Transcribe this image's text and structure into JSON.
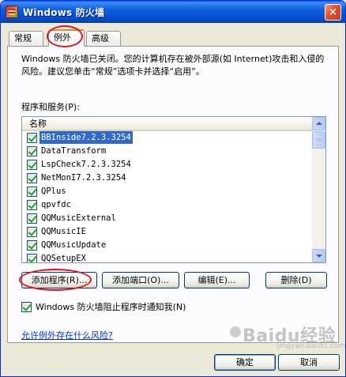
{
  "window": {
    "title": "Windows 防火墙",
    "close_label": "×"
  },
  "tabs": [
    {
      "label": "常规",
      "active": false
    },
    {
      "label": "例外",
      "active": true
    },
    {
      "label": "高级",
      "active": false
    }
  ],
  "info_text": "Windows 防火墙已关闭。您的计算机存在被外部源(如 Internet)攻击和入侵的风险。建议您单击“常规”选项卡并选择“启用”。",
  "list": {
    "caption": "程序和服务(P):",
    "header": "名称",
    "items": [
      {
        "label": "BBInside7.2.3.3254",
        "checked": true,
        "selected": true
      },
      {
        "label": "DataTransform",
        "checked": true,
        "selected": false
      },
      {
        "label": "LspCheck7.2.3.3254",
        "checked": true,
        "selected": false
      },
      {
        "label": "NetMonI7.2.3.3254",
        "checked": true,
        "selected": false
      },
      {
        "label": "QPlus",
        "checked": true,
        "selected": false
      },
      {
        "label": "qpvfdc",
        "checked": true,
        "selected": false
      },
      {
        "label": "QQMusicExternal",
        "checked": true,
        "selected": false
      },
      {
        "label": "QQMusicIE",
        "checked": true,
        "selected": false
      },
      {
        "label": "QQMusicUpdate",
        "checked": true,
        "selected": false
      },
      {
        "label": "QQSetupEX",
        "checked": true,
        "selected": false
      }
    ]
  },
  "buttons": {
    "add_program": "添加程序(R)...",
    "add_port": "添加端口(O)...",
    "edit": "编辑(E)...",
    "delete": "删除(D)",
    "ok": "确定",
    "cancel": "取消"
  },
  "notify": {
    "label": "Windows 防火墙阻止程序时通知我(N)",
    "checked": true
  },
  "risk_link": "允许例外存在什么风险?",
  "watermark": {
    "main": "Baidu经验",
    "sub": "jingyan.baidu.com"
  },
  "colors": {
    "titlebar": "#0b5fdf",
    "selection": "#316ac5",
    "annotation_circle": "#e0141e",
    "tab_accent": "#e68b2c",
    "link": "#0033cc"
  }
}
